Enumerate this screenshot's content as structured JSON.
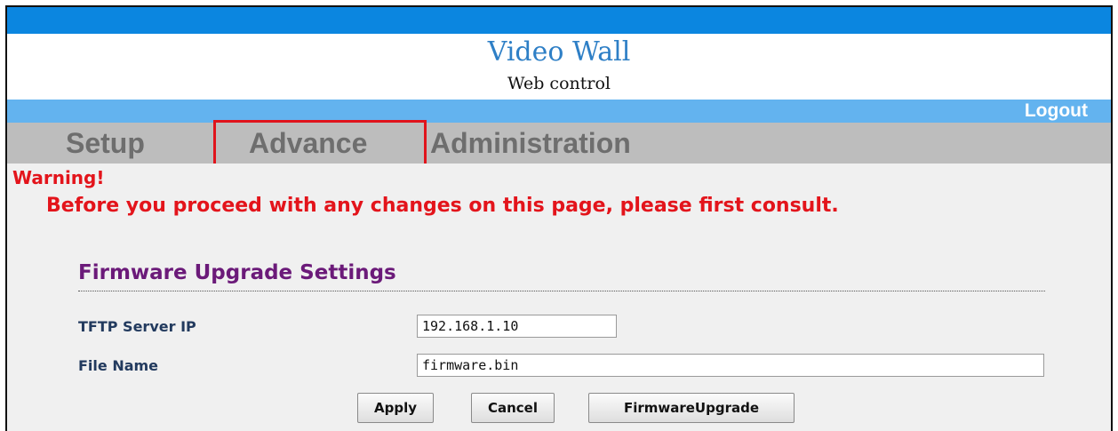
{
  "header": {
    "title": "Video Wall",
    "subtitle": "Web control"
  },
  "logout_label": "Logout",
  "tabs": [
    {
      "label": "Setup"
    },
    {
      "label": "Advance",
      "selected": true
    },
    {
      "label": "Administration"
    }
  ],
  "warning": {
    "title": "Warning!",
    "message": "Before you proceed with any changes on this page, please first consult."
  },
  "firmware": {
    "section_title": "Firmware Upgrade Settings",
    "tftp_label": "TFTP Server IP",
    "tftp_value": "192.168.1.10",
    "file_label": "File Name",
    "file_value": "firmware.bin"
  },
  "buttons": {
    "apply": "Apply",
    "cancel": "Cancel",
    "firmware_upgrade": "FirmwareUpgrade"
  },
  "colors": {
    "top_bar": "#0b86e0",
    "logout_bar": "#63b3ef",
    "tab_bar": "#bdbdbd",
    "warning": "#e3141b",
    "section_title": "#6b1a79",
    "highlight_box": "#e0141c"
  }
}
